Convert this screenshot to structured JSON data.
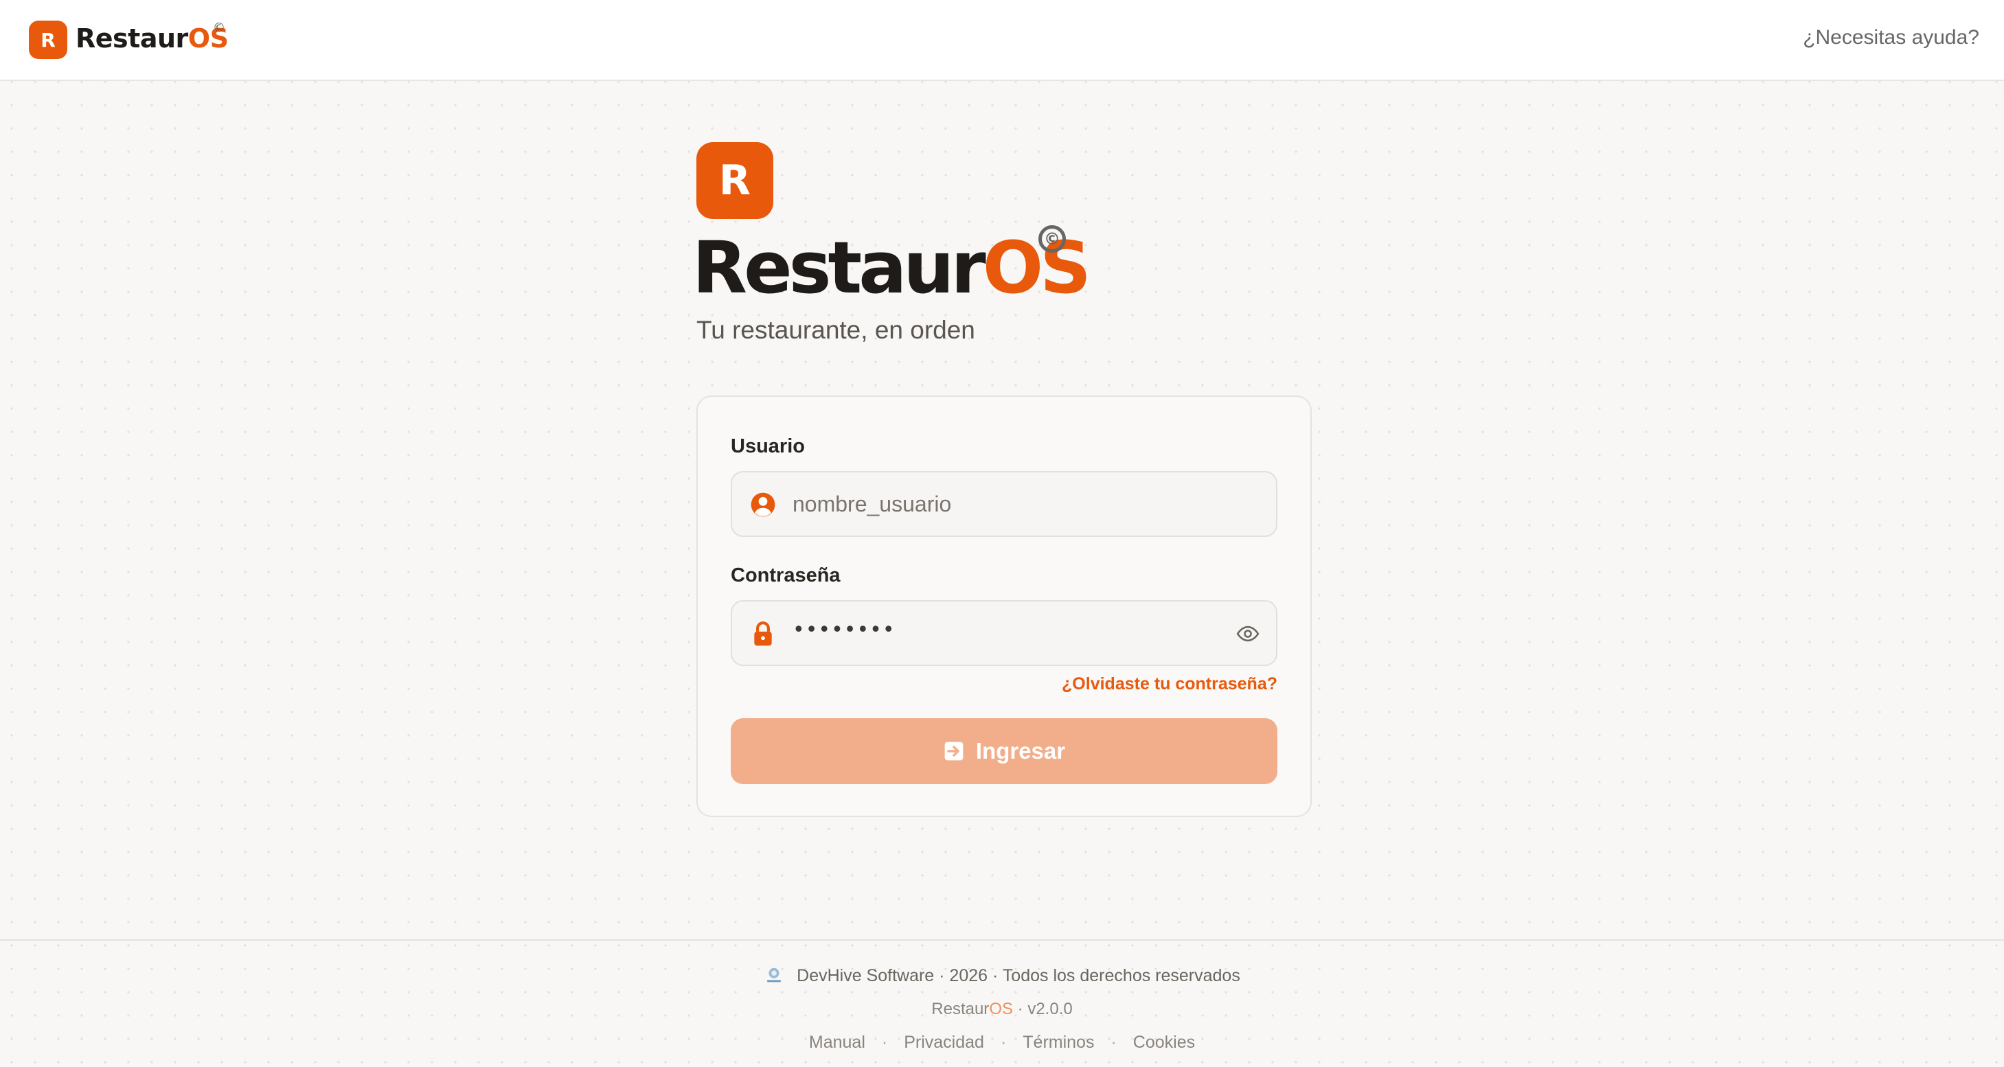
{
  "header": {
    "logo_letter": "R",
    "brand_dark": "Restaur",
    "brand_accent": "OS",
    "copyright_symbol": "©",
    "help_link": "¿Necesitas ayuda?"
  },
  "hero": {
    "logo_letter": "R",
    "brand_dark": "Restaur",
    "brand_accent": "OS",
    "copyright_symbol": "©",
    "tagline": "Tu restaurante, en orden"
  },
  "login_form": {
    "username_label": "Usuario",
    "username_placeholder": "nombre_usuario",
    "username_icon": "user-circle-icon",
    "password_label": "Contraseña",
    "password_value": "••••••••",
    "password_icon": "lock-icon",
    "toggle_visibility_icon": "eye-icon",
    "forgot_password": "¿Olvidaste tu contraseña?",
    "submit_label": "Ingresar",
    "submit_icon": "login-arrow-icon"
  },
  "footer": {
    "company_line": "DevHive Software · 2026 · Todos los derechos reservados",
    "version_brand_dark": "Restaur",
    "version_brand_accent": "OS",
    "version_suffix": " · v2.0.0",
    "links": [
      "Manual",
      "Privacidad",
      "Términos",
      "Cookies"
    ],
    "separator": "·"
  },
  "colors": {
    "accent": "#e8590c",
    "button_disabled": "#f2ae8b",
    "background": "#f8f7f5"
  }
}
